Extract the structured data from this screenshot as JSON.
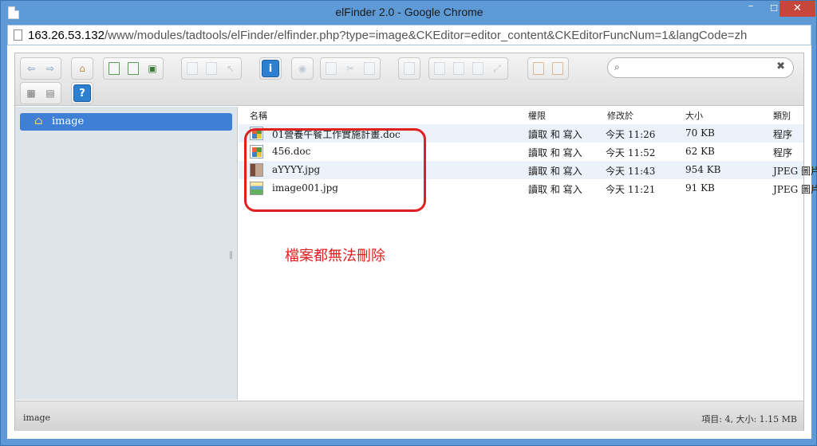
{
  "window": {
    "title": "elFinder 2.0 - Google Chrome",
    "minimize": "–",
    "maximize": "☐",
    "close": "✕"
  },
  "address": {
    "host": "163.26.53.132",
    "path": "/www/modules/tadtools/elFinder/elfinder.php?type=image&CKEditor=editor_content&CKEditorFuncNum=1&langCode=zh"
  },
  "toolbar": {
    "groups": [
      {
        "buttons": [
          "back-icon",
          "forward-icon"
        ]
      },
      {
        "buttons": [
          "home-icon"
        ]
      },
      {
        "buttons": [
          "reload-icon",
          "mkdir-icon",
          "save-icon"
        ]
      },
      {
        "buttons": [
          "open-icon",
          "download-icon",
          "select-icon"
        ]
      },
      {
        "buttons": [
          "info-icon"
        ]
      },
      {
        "buttons": [
          "view-icon"
        ]
      },
      {
        "buttons": [
          "copy-icon",
          "cut-icon",
          "paste-icon"
        ]
      },
      {
        "buttons": [
          "delete-icon"
        ]
      },
      {
        "buttons": [
          "duplicate-icon",
          "rename-icon",
          "edit-icon",
          "resize-icon"
        ]
      },
      {
        "buttons": [
          "archive-icon",
          "extract-icon"
        ]
      },
      {
        "buttons": [
          "view-list-icon",
          "sort-icon"
        ]
      },
      {
        "buttons": [
          "help-icon"
        ]
      }
    ],
    "info_label": "i",
    "help_label": "?",
    "search_icon": "⌕",
    "search_clear": "✖",
    "search_placeholder": ""
  },
  "tree": {
    "root_label": "image",
    "root_icon": "house-icon"
  },
  "columns": {
    "name": "名稱",
    "perm": "權限",
    "date": "修改於",
    "size": "大小",
    "kind": "類別"
  },
  "files": [
    {
      "name": "01營養午餐工作實施計畫.doc",
      "perm": "讀取 和 寫入",
      "date": "今天 11:26",
      "size": "70 KB",
      "kind": "程序",
      "icon": "doc"
    },
    {
      "name": "456.doc",
      "perm": "讀取 和 寫入",
      "date": "今天 11:52",
      "size": "62 KB",
      "kind": "程序",
      "icon": "doc"
    },
    {
      "name": "aYYYY.jpg",
      "perm": "讀取 和 寫入",
      "date": "今天 11:43",
      "size": "954 KB",
      "kind": "JPEG 圖片",
      "icon": "img1"
    },
    {
      "name": "image001.jpg",
      "perm": "讀取 和 寫入",
      "date": "今天 11:21",
      "size": "91 KB",
      "kind": "JPEG 圖片",
      "icon": "img2"
    }
  ],
  "annotation": {
    "text": "檔案都無法刪除",
    "color": "#e02020"
  },
  "status": {
    "path": "image",
    "info": "項目: 4, 大小: 1.15 MB"
  }
}
